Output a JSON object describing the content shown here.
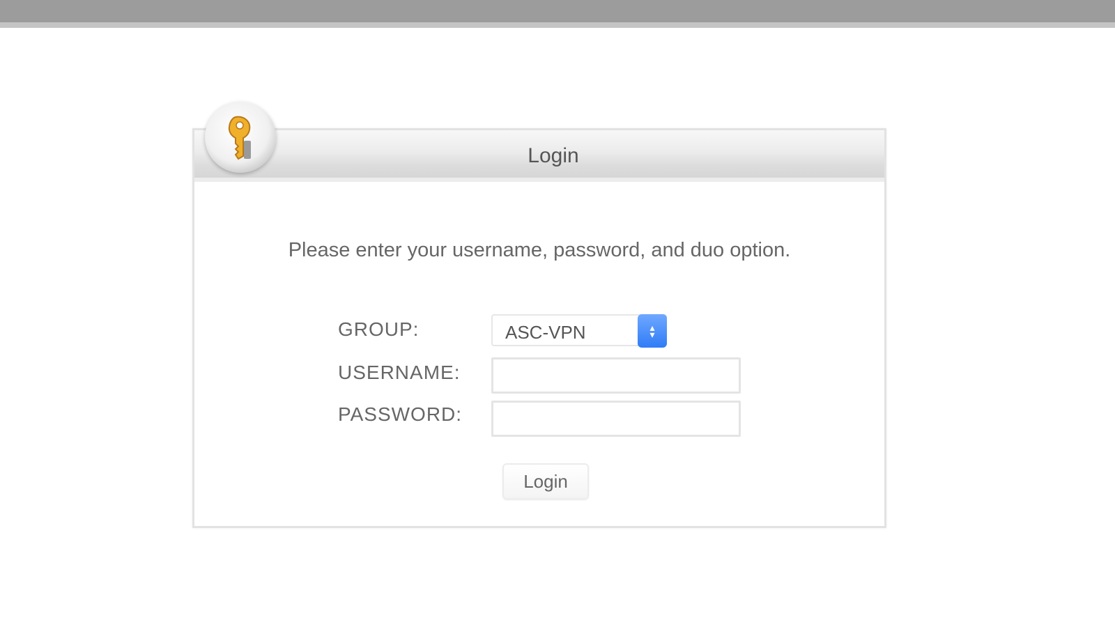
{
  "dialog": {
    "title": "Login",
    "instructions": "Please enter your username, password, and duo option.",
    "icon": "key-icon"
  },
  "form": {
    "group": {
      "label": "GROUP:",
      "selected_value": "ASC-VPN"
    },
    "username": {
      "label": "USERNAME:",
      "value": ""
    },
    "password": {
      "label": "PASSWORD:",
      "value": ""
    },
    "submit_label": "Login"
  },
  "colors": {
    "accent": "#2f7cf6",
    "top_bar": "#9c9c9c",
    "key_gold": "#f0b02a"
  }
}
